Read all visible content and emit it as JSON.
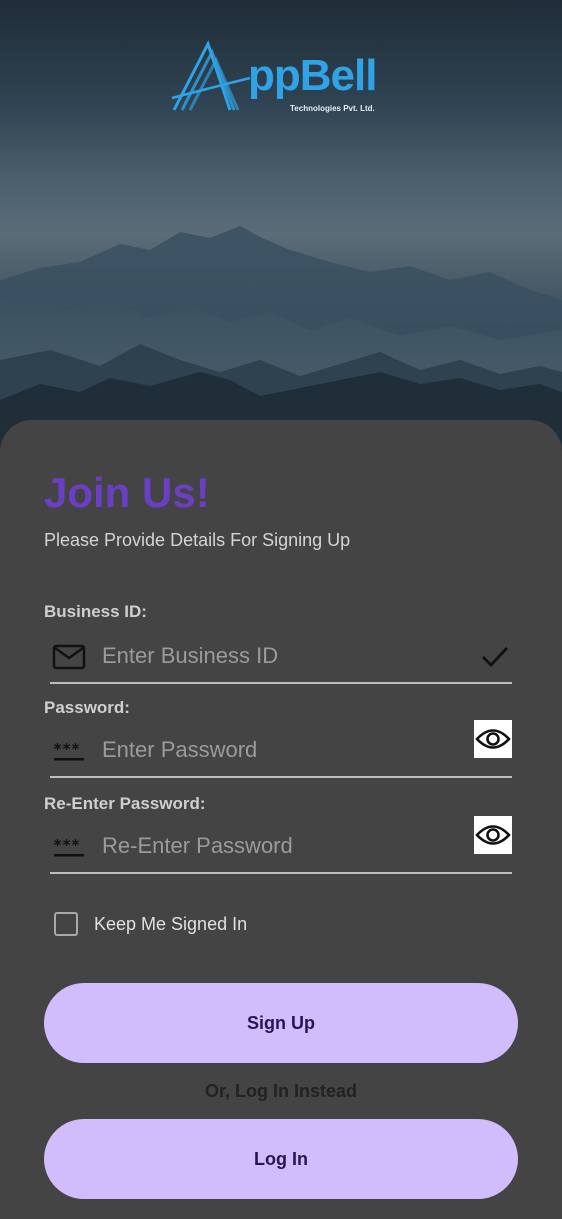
{
  "logo": {
    "name": "ppBell",
    "tagline": "Technologies Pvt. Ltd."
  },
  "form": {
    "title": "Join Us!",
    "subtitle": "Please Provide Details For Signing Up",
    "business_id": {
      "label": "Business ID:",
      "placeholder": "Enter Business ID",
      "value": "",
      "leading_icon": "mail-icon",
      "trailing_icon": "check-icon"
    },
    "password": {
      "label": "Password:",
      "placeholder": "Enter Password",
      "value": "",
      "leading_icon": "password-icon",
      "trailing_icon": "eye-icon"
    },
    "reenter_password": {
      "label": "Re-Enter Password:",
      "placeholder": "Re-Enter Password",
      "value": "",
      "leading_icon": "password-icon",
      "trailing_icon": "eye-icon"
    },
    "keep_signed_in": {
      "label": "Keep Me Signed In",
      "checked": false
    },
    "signup_label": "Sign Up",
    "or_text": "Or, Log In Instead",
    "login_label": "Log In"
  },
  "colors": {
    "title": "#6b3fc4",
    "button": "#d1bcfc",
    "button_text": "#2a1552",
    "card": "#444444",
    "logo_blue": "#2fa3e6"
  }
}
